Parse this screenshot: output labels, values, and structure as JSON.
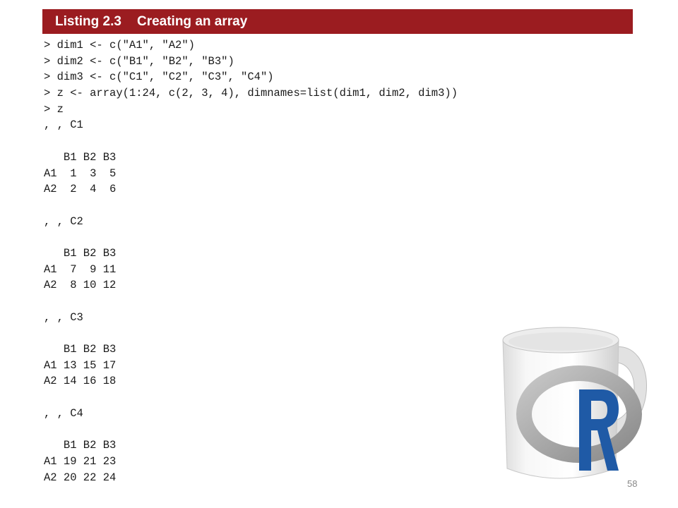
{
  "listing": {
    "id": "Listing 2.3",
    "title": "Creating an array"
  },
  "code_lines": [
    "> dim1 <- c(\"A1\", \"A2\")",
    "> dim2 <- c(\"B1\", \"B2\", \"B3\")",
    "> dim3 <- c(\"C1\", \"C2\", \"C3\", \"C4\")",
    "> z <- array(1:24, c(2, 3, 4), dimnames=list(dim1, dim2, dim3))",
    "> z",
    ", , C1",
    "",
    "   B1 B2 B3",
    "A1  1  3  5",
    "A2  2  4  6",
    "",
    ", , C2",
    "",
    "   B1 B2 B3",
    "A1  7  9 11",
    "A2  8 10 12",
    "",
    ", , C3",
    "",
    "   B1 B2 B3",
    "A1 13 15 17",
    "A2 14 16 18",
    "",
    ", , C4",
    "",
    "   B1 B2 B3",
    "A1 19 21 23",
    "A2 20 22 24"
  ],
  "page_number": "58",
  "mug_logo": {
    "letter": "R",
    "icon": "r-logo-mug-icon"
  },
  "colors": {
    "banner": "#9b1c20",
    "r_blue": "#1f5aa6"
  }
}
